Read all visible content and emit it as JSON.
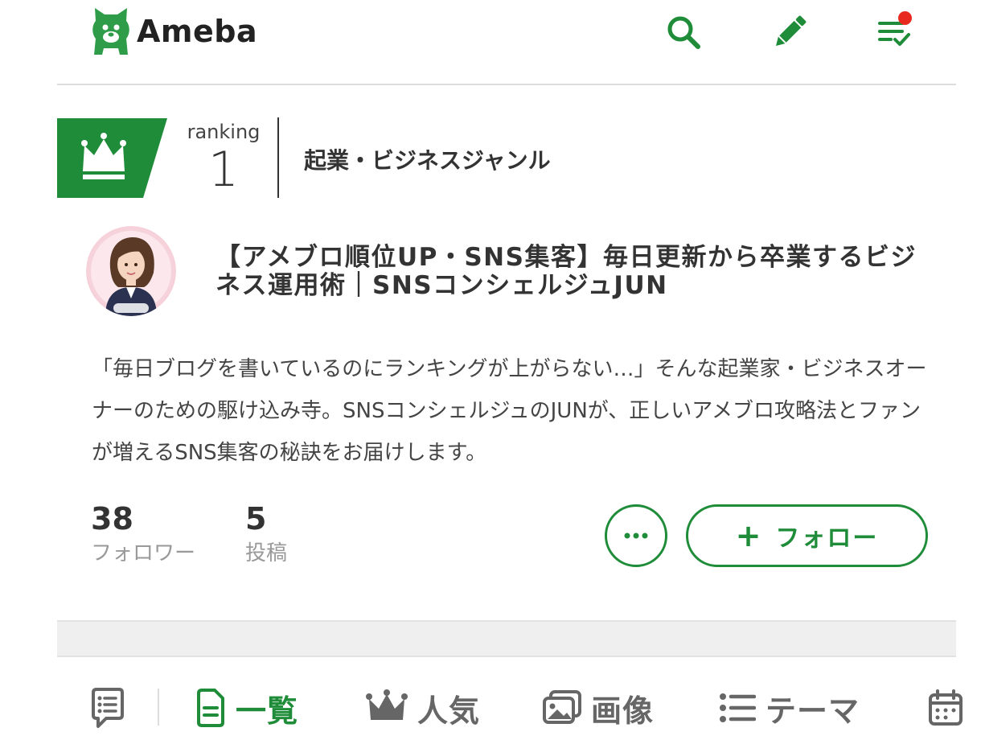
{
  "header": {
    "logo_text": "Ameba"
  },
  "ranking": {
    "label": "ranking",
    "position": "1",
    "genre": "起業・ビジネスジャンル"
  },
  "blog": {
    "title": "【アメブロ順位UP・SNS集客】毎日更新から卒業するビジネス運用術｜SNSコンシェルジュJUN",
    "description": "「毎日ブログを書いているのにランキングが上がらない…」そんな起業家・ビジネスオーナーのための駆け込み寺。SNSコンシェルジュのJUNが、正しいアメブロ攻略法とファンが増えるSNS集客の秘訣をお届けします。",
    "avatar_caption": "JUN"
  },
  "stats": {
    "followers_count": "38",
    "followers_label": "フォロワー",
    "posts_count": "5",
    "posts_label": "投稿"
  },
  "actions": {
    "follow_plus": "+",
    "follow_label": "フォロー"
  },
  "tabs": [
    {
      "label": "",
      "icon": "message-icon"
    },
    {
      "label": "一覧",
      "icon": "document-icon"
    },
    {
      "label": "人気",
      "icon": "crown-icon"
    },
    {
      "label": "画像",
      "icon": "image-icon"
    },
    {
      "label": "テーマ",
      "icon": "list-icon"
    },
    {
      "label": "",
      "icon": "calendar-icon"
    }
  ],
  "colors": {
    "brand_green": "#1e8c38",
    "notification": "#e8291f"
  }
}
